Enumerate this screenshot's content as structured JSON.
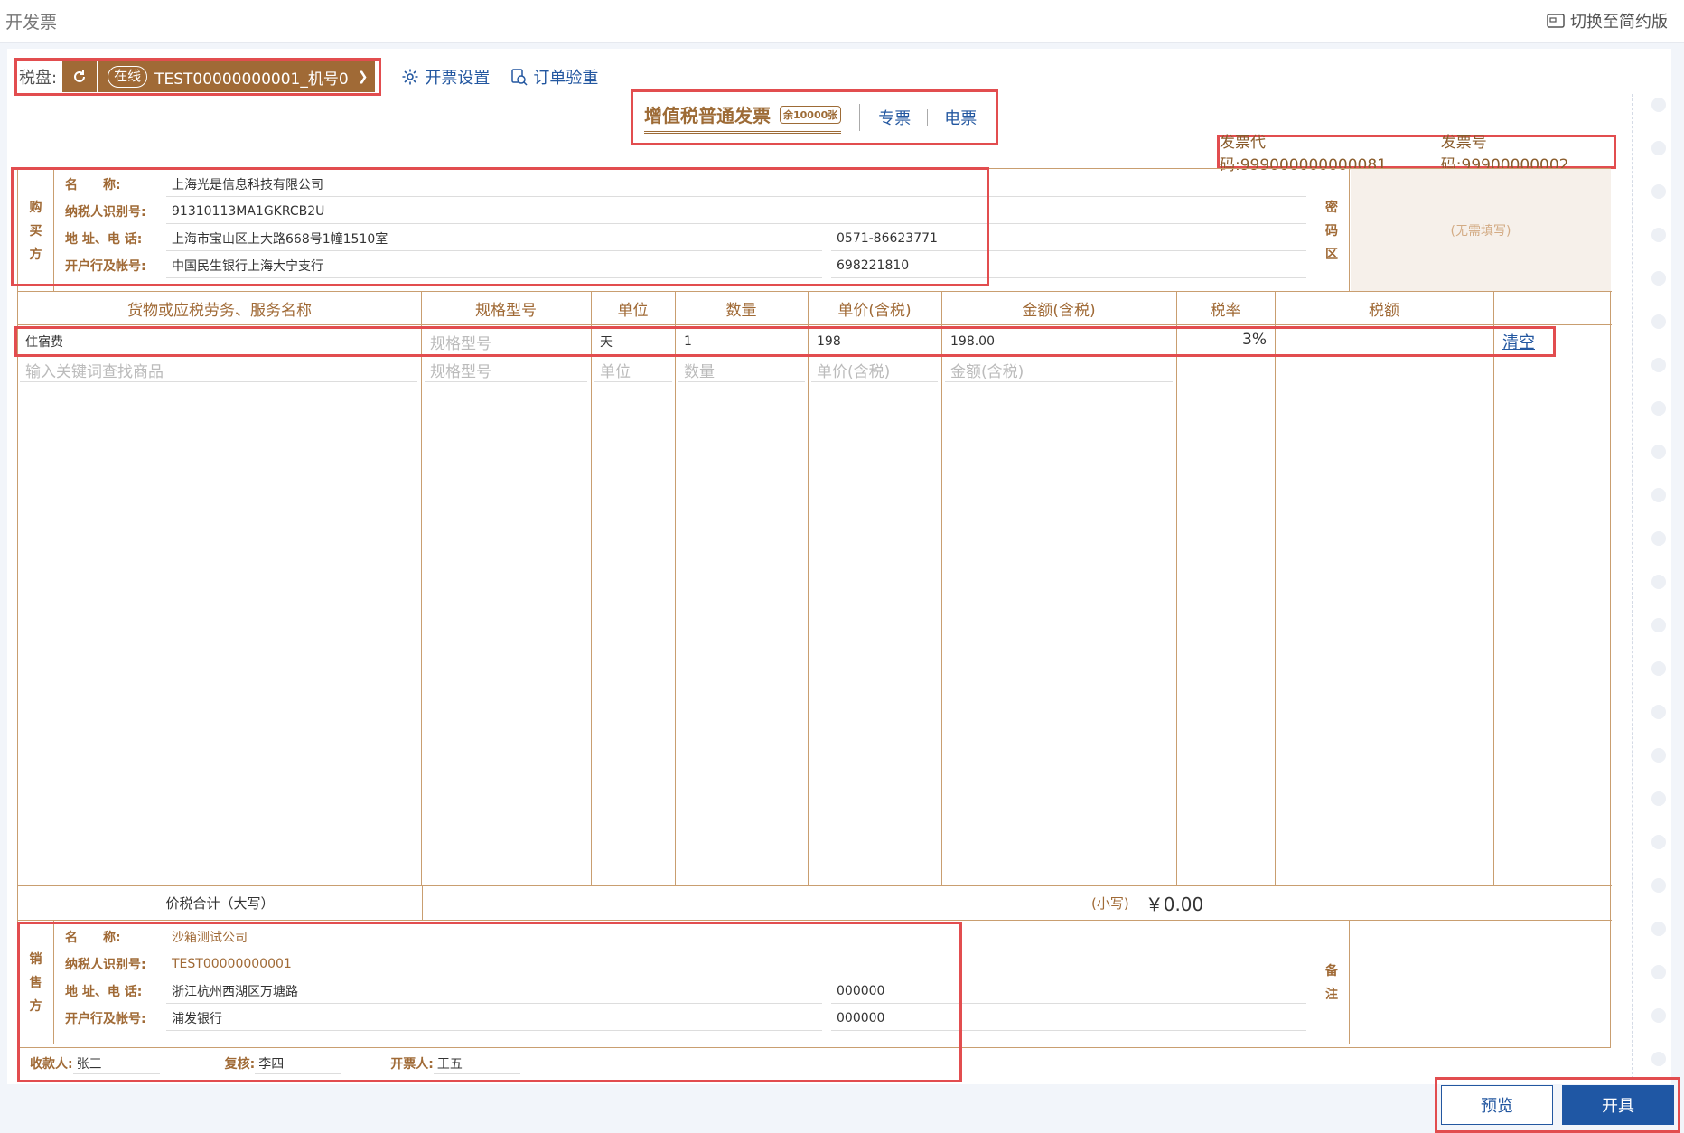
{
  "header": {
    "title": "开发票",
    "switch_label": "切换至简约版"
  },
  "toolbar": {
    "disk_label": "税盘:",
    "online_label": "在线",
    "disk_name": "TEST00000000001_机号0",
    "settings_label": "开票设置",
    "check_label": "订单验重"
  },
  "invoice_type": {
    "title": "增值税普通发票",
    "remaining": "余10000张",
    "special": "专票",
    "electronic": "电票"
  },
  "codes": {
    "code": "发票代码:999000000000081",
    "number": "发票号码:99900000002"
  },
  "buyer": {
    "side_label": [
      "购",
      "买",
      "方"
    ],
    "name_key": "名　　称:",
    "name": "上海光是信息科技有限公司",
    "tax_key": "纳税人识别号:",
    "tax_id": "91310113MA1GKRCB2U",
    "addr_key": "地 址、电 话:",
    "address": "上海市宝山区上大路668号1幢1510室",
    "phone": "0571-86623771",
    "bank_key": "开户行及帐号:",
    "bank": "中国民生银行上海大宁支行",
    "account": "698221810"
  },
  "secret": {
    "side_label": [
      "密",
      "码",
      "区"
    ],
    "note": "(无需填写)"
  },
  "columns": [
    "货物或应税劳务、服务名称",
    "规格型号",
    "单位",
    "数量",
    "单价(含税)",
    "金额(含税)",
    "税率",
    "税额"
  ],
  "item": {
    "name": "住宿费",
    "spec_placeholder": "规格型号",
    "unit": "天",
    "qty": "1",
    "price": "198",
    "amount": "198.00",
    "rate": "3%",
    "clear": "清空"
  },
  "new_row": {
    "name_placeholder": "输入关键词查找商品",
    "spec_placeholder": "规格型号",
    "unit_placeholder": "单位",
    "qty_placeholder": "数量",
    "price_placeholder": "单价(含税)",
    "amount_placeholder": "金额(含税)"
  },
  "total": {
    "label": "价税合计（大写）",
    "small_label": "(小写)",
    "small_value": "￥0.00"
  },
  "seller": {
    "side_label": [
      "销",
      "售",
      "方"
    ],
    "name_key": "名　　称:",
    "name": "沙箱测试公司",
    "tax_key": "纳税人识别号:",
    "tax_id": "TEST00000000001",
    "addr_key": "地 址、电 话:",
    "address": "浙江杭州西湖区万塘路",
    "phone": "000000",
    "bank_key": "开户行及帐号:",
    "bank": "浦发银行",
    "account": "000000"
  },
  "remark": {
    "side_label": [
      "备",
      "注"
    ]
  },
  "sign": {
    "payee_key": "收款人:",
    "payee": "张三",
    "reviewer_key": "复核:",
    "reviewer": "李四",
    "drawer_key": "开票人:",
    "drawer": "王五"
  },
  "footer": {
    "preview": "预览",
    "issue": "开具"
  },
  "colors": {
    "brown": "#a06a36",
    "blue": "#2357a0",
    "highlight": "#e24d4f"
  }
}
